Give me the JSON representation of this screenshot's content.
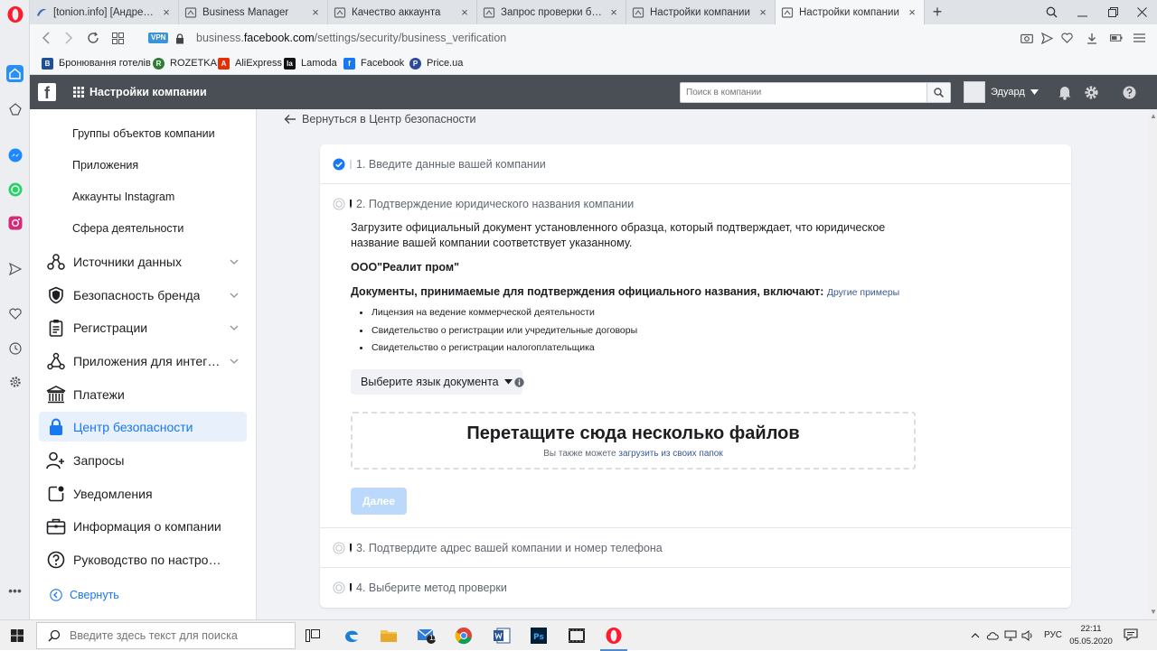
{
  "browser": {
    "tabs": [
      {
        "title": "[tonion.info] [Андрей Мизь",
        "icon": "tonion-favicon"
      },
      {
        "title": "Business Manager",
        "icon": "page-favicon"
      },
      {
        "title": "Качество аккаунта",
        "icon": "page-favicon"
      },
      {
        "title": "Запрос проверки бизнес",
        "icon": "page-favicon"
      },
      {
        "title": "Настройки компании",
        "icon": "page-favicon"
      },
      {
        "title": "Настройки компании",
        "icon": "page-favicon"
      }
    ],
    "new_tab": "+",
    "vpn": "VPN",
    "url_prefix": "business.",
    "url_domain": "facebook.com",
    "url_path": "/settings/security/business_verification",
    "bookmarks": [
      {
        "label": "Бронювання готелів",
        "icon": "B",
        "color": "#1f4f99"
      },
      {
        "label": "ROZETKA",
        "icon": "R",
        "color": "#2e7d32"
      },
      {
        "label": "AliExpress",
        "icon": "A",
        "color": "#e62e04"
      },
      {
        "label": "Lamoda",
        "icon": "la",
        "color": "#111111"
      },
      {
        "label": "Facebook",
        "icon": "f",
        "color": "#1877f2"
      },
      {
        "label": "Price.ua",
        "icon": "P",
        "color": "#2c4a9a"
      }
    ]
  },
  "header": {
    "title": "Настройки компании",
    "search_placeholder": "Поиск в компании",
    "user_name": "Эдуард"
  },
  "sidebar": {
    "sub_items": [
      "Группы объектов компании",
      "Приложения",
      "Аккаунты Instagram",
      "Сфера деятельности"
    ],
    "items": [
      {
        "label": "Источники данных",
        "icon": "data-sources-icon",
        "expandable": true
      },
      {
        "label": "Безопасность бренда",
        "icon": "shield-icon",
        "expandable": true
      },
      {
        "label": "Регистрации",
        "icon": "clipboard-icon",
        "expandable": true
      },
      {
        "label": "Приложения для интеграции",
        "icon": "integrations-icon",
        "expandable": true
      },
      {
        "label": "Платежи",
        "icon": "bank-icon",
        "expandable": false
      },
      {
        "label": "Центр безопасности",
        "icon": "lock-icon",
        "expandable": false,
        "active": true
      },
      {
        "label": "Запросы",
        "icon": "person-add-icon",
        "expandable": false
      },
      {
        "label": "Уведомления",
        "icon": "notification-icon",
        "expandable": false
      },
      {
        "label": "Информация о компании",
        "icon": "briefcase-icon",
        "expandable": false
      },
      {
        "label": "Руководство по настройке",
        "icon": "question-icon",
        "expandable": false
      }
    ],
    "collapse_label": "Свернуть"
  },
  "main": {
    "back_link": "Вернуться в Центр безопасности",
    "steps": [
      {
        "label": "1. Введите данные вашей компании",
        "status": "done"
      },
      {
        "label": "2. Подтверждение юридического названия компании",
        "status": "current"
      },
      {
        "label": "3. Подтвердите адрес вашей компании и номер телефона",
        "status": "pending"
      },
      {
        "label": "4. Выберите метод проверки",
        "status": "pending"
      }
    ],
    "description": "Загрузите официальный документ установленного образца, который подтверждает, что юридическое название вашей компании соответствует указанному.",
    "company_name": "ООО\"Реалит пром\"",
    "docs_heading": "Документы, принимаемые для подтверждения официального названия, включают:",
    "docs_link": "Другие примеры",
    "docs": [
      "Лицензия на ведение коммерческой деятельности",
      "Свидетельство о регистрации или учредительные договоры",
      "Свидетельство о регистрации налогоплательщика"
    ],
    "language_select": "Выберите язык документа",
    "dropzone_title": "Перетащите сюда несколько файлов",
    "dropzone_sub_prefix": "Вы также можете",
    "dropzone_sub_link": "загрузить из своих папок",
    "next_button": "Далее"
  },
  "taskbar": {
    "search_placeholder": "Введите здесь текст для поиска",
    "mail_badge": "11",
    "language": "РУС",
    "time": "22:11",
    "date": "05.05.2020"
  },
  "colors": {
    "fb_header": "#4a4f56",
    "accent": "#1877f2",
    "active_bg": "#e7f0fb",
    "next_disabled": "#bcd9fb"
  }
}
